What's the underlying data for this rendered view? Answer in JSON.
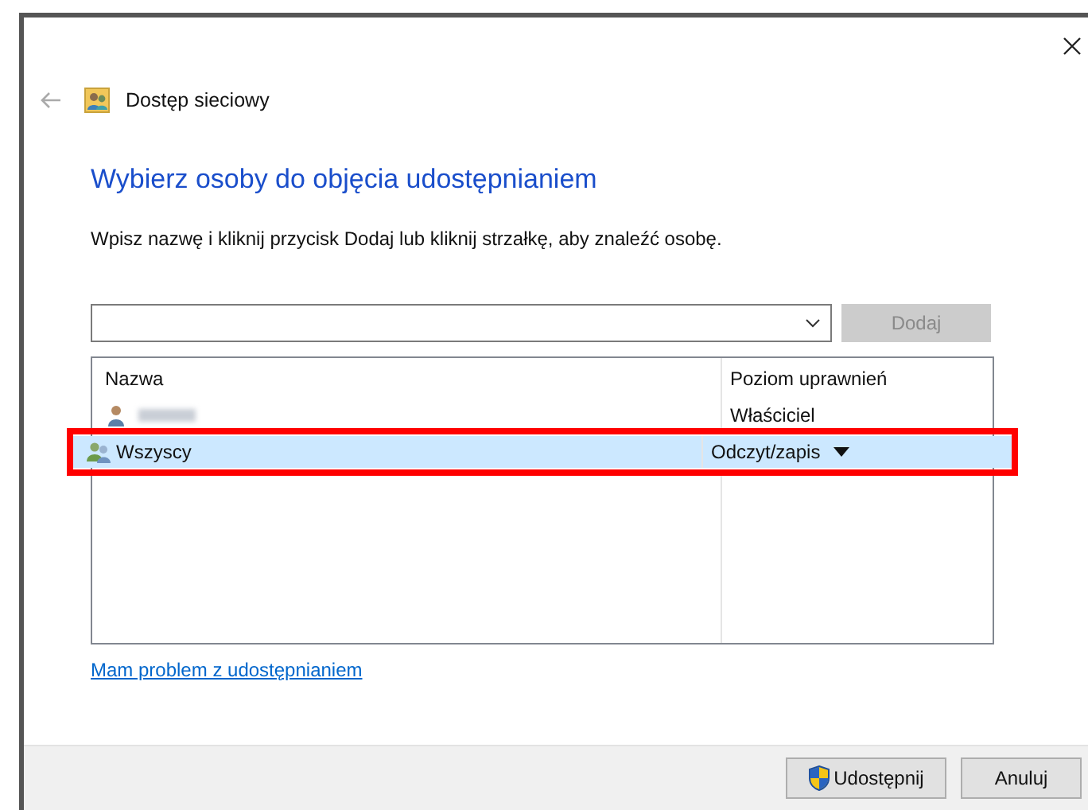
{
  "window": {
    "title": "Dostęp sieciowy"
  },
  "heading": "Wybierz osoby do objęcia udostępnianiem",
  "instruction": "Wpisz nazwę i kliknij przycisk Dodaj lub kliknij strzałkę, aby znaleźć osobę.",
  "add_button": {
    "label": "Dodaj",
    "disabled": true
  },
  "table": {
    "columns": [
      "Nazwa",
      "Poziom uprawnień"
    ],
    "rows": [
      {
        "kind": "user",
        "name_blurred": true,
        "permission": "Właściciel",
        "has_dropdown": false,
        "selected": false,
        "highlighted": false
      },
      {
        "kind": "group",
        "name_blurred": false,
        "name": "Wszyscy",
        "permission": "Odczyt/zapis",
        "has_dropdown": true,
        "selected": true,
        "highlighted": true
      }
    ]
  },
  "help_link": "Mam problem z udostępnianiem",
  "buttons": [
    {
      "kind": "shield",
      "label": "Udostępnij"
    },
    {
      "kind": "plain",
      "label": "Anuluj"
    }
  ]
}
